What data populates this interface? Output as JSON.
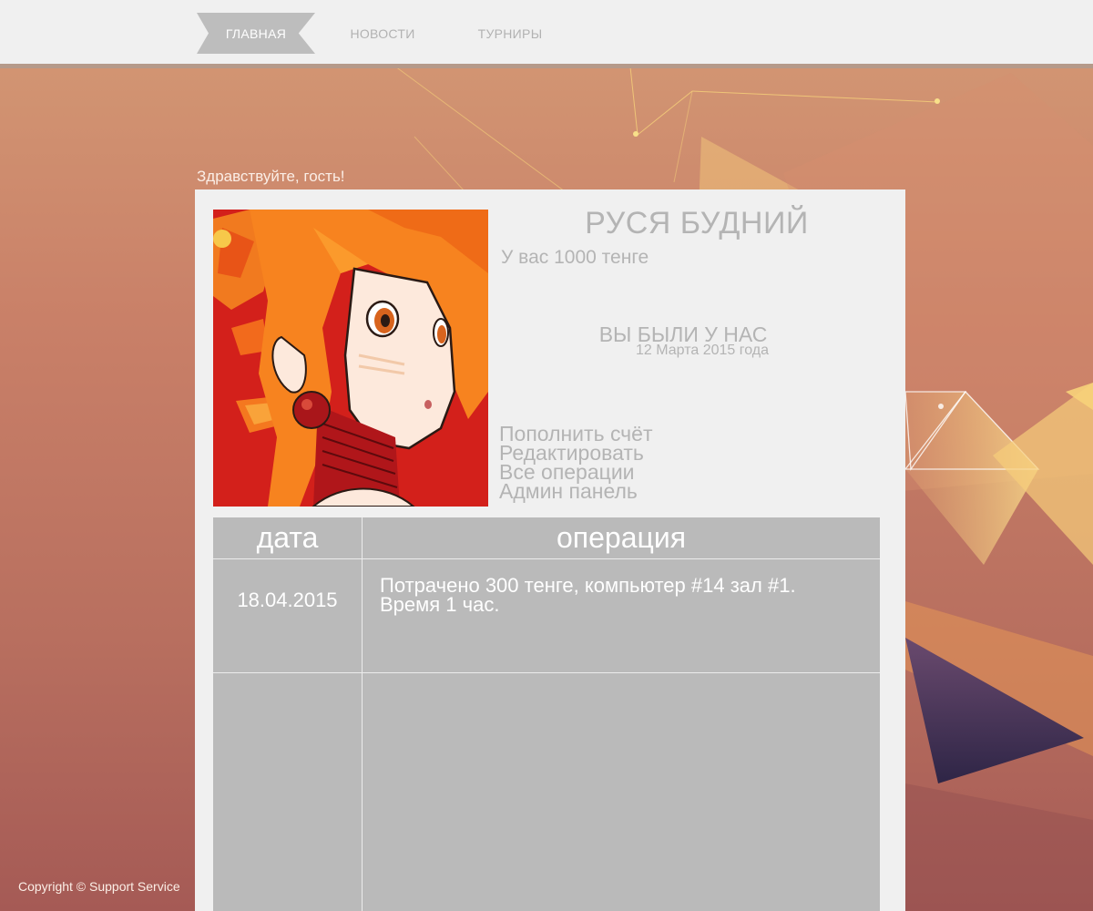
{
  "nav": {
    "items": [
      {
        "label": "ГЛАВНАЯ",
        "active": true
      },
      {
        "label": "НОВОСТИ",
        "active": false
      },
      {
        "label": "ТУРНИРЫ",
        "active": false
      }
    ]
  },
  "greeting": "Здравствуйте, гость!",
  "profile": {
    "name": "РУСЯ БУДНИЙ",
    "balance": "У вас 1000 тенге",
    "visit_title": "ВЫ БЫЛИ У НАС",
    "visit_date": "12 Марта 2015 года"
  },
  "menu": {
    "items": [
      "Пополнить счёт",
      "Редактировать",
      "Все операции",
      "Админ панель"
    ]
  },
  "operations": {
    "headers": {
      "date": "дата",
      "operation": "операция"
    },
    "rows": [
      {
        "date": "18.04.2015",
        "operation_line1": "Потрачено 300 тенге, компьютер #14 зал #1.",
        "operation_line2": "Время 1 час."
      }
    ]
  },
  "footer": {
    "copyright": "Copyright © Support Service"
  },
  "colors": {
    "nav_active_bg": "#bdbdbd",
    "panel_bg": "#f0f0f0",
    "table_bg": "#bababa",
    "muted_text": "#b4b4b4"
  }
}
